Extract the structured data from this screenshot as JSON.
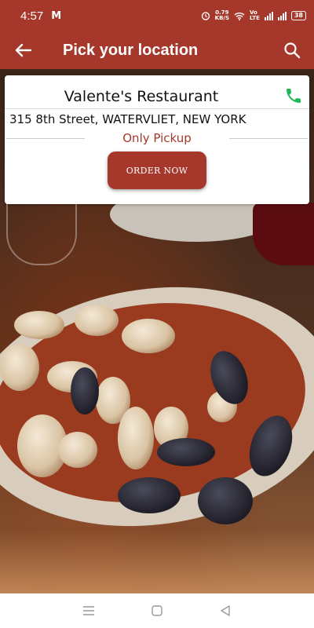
{
  "status_bar": {
    "time": "4:57",
    "notification_icon": "M",
    "speed_value": "0.79",
    "speed_unit": "KB/S",
    "volte_top": "Vo",
    "volte_bottom": "LTE",
    "battery": "38"
  },
  "app_bar": {
    "title": "Pick your location",
    "back_icon": "arrow-left-icon",
    "search_icon": "search-icon"
  },
  "location_card": {
    "restaurant_name": "Valente's Restaurant",
    "address": "315 8th Street, WATERVLIET, NEW YORK",
    "service_type": "Only Pickup",
    "order_button_label": "ORDER NOW",
    "phone_icon": "phone-icon"
  },
  "colors": {
    "brand": "#a5372b",
    "phone": "#1db954"
  },
  "nav_bar": {
    "icons": [
      "menu-icon",
      "home-square-icon",
      "back-triangle-icon"
    ]
  }
}
